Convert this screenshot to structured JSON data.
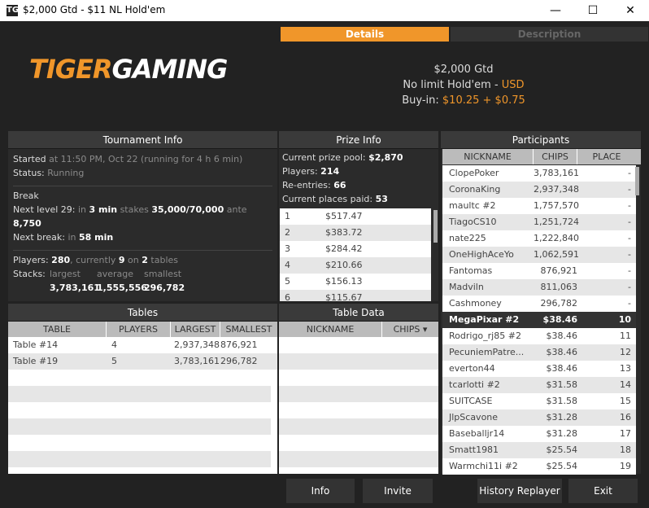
{
  "window": {
    "title": "$2,000 Gtd - $11 NL Hold'em",
    "app_icon": "TG",
    "minimize": "—",
    "maximize": "☐",
    "close": "✕"
  },
  "tabs": {
    "details": "Details",
    "description": "Description"
  },
  "logo": {
    "part1": "TIGER",
    "part2": "GAMING"
  },
  "tournament": {
    "name": "$2,000 Gtd",
    "game": "No limit Hold'em",
    "dash": "-",
    "currency": "USD",
    "buyin_label": "Buy-in:",
    "buyin_value": "$10.25 + $0.75"
  },
  "tournament_info": {
    "title": "Tournament Info",
    "started_label": "Started",
    "started_value": "at 11:50 PM, Oct 22 (running for 4 h 6 min)",
    "status_label": "Status:",
    "status_value": "Running",
    "break": "Break",
    "next_level_label": "Next level 29:",
    "in1": "in",
    "next_level_time": "3 min",
    "stakes_label": "stakes",
    "stakes_value": "35,000/70,000",
    "ante_label": "ante",
    "ante_value": "8,750",
    "next_break_label": "Next break:",
    "in2": "in",
    "next_break_value": "58 min",
    "players_label": "Players:",
    "players_total": "280",
    "currently": ", currently",
    "players_current": "9",
    "on": "on",
    "tables_count": "2",
    "tables_word": "tables",
    "stacks_label": "Stacks:",
    "largest_label": "largest",
    "average_label": "average",
    "smallest_label": "smallest",
    "largest": "3,783,161",
    "average": "1,555,556",
    "smallest": "296,782"
  },
  "prize_info": {
    "title": "Prize Info",
    "pool_label": "Current prize pool:",
    "pool_value": "$2,870",
    "players_label": "Players:",
    "players_value": "214",
    "reentries_label": "Re-entries:",
    "reentries_value": "66",
    "places_label": "Current places paid:",
    "places_value": "53",
    "payouts": [
      {
        "place": "1",
        "amount": "$517.47"
      },
      {
        "place": "2",
        "amount": "$383.72"
      },
      {
        "place": "3",
        "amount": "$284.42"
      },
      {
        "place": "4",
        "amount": "$210.66"
      },
      {
        "place": "5",
        "amount": "$156.13"
      },
      {
        "place": "6",
        "amount": "$115.67"
      }
    ]
  },
  "participants": {
    "title": "Participants",
    "columns": [
      "NICKNAME",
      "CHIPS",
      "PLACE"
    ],
    "rows": [
      {
        "name": "ClopePoker",
        "chips": "3,783,161",
        "place": "-"
      },
      {
        "name": "CoronaKing",
        "chips": "2,937,348",
        "place": "-"
      },
      {
        "name": "maultc #2",
        "chips": "1,757,570",
        "place": "-"
      },
      {
        "name": "TiagoCS10",
        "chips": "1,251,724",
        "place": "-"
      },
      {
        "name": "nate225",
        "chips": "1,222,840",
        "place": "-"
      },
      {
        "name": "OneHighAceYo",
        "chips": "1,062,591",
        "place": "-"
      },
      {
        "name": "Fantomas",
        "chips": "876,921",
        "place": "-"
      },
      {
        "name": "Madviln",
        "chips": "811,063",
        "place": "-"
      },
      {
        "name": "Cashmoney",
        "chips": "296,782",
        "place": "-"
      },
      {
        "name": "MegaPixar #2",
        "chips": "$38.46",
        "place": "10"
      },
      {
        "name": "Rodrigo_rj85 #2",
        "chips": "$38.46",
        "place": "11"
      },
      {
        "name": "PecuniemPatre...",
        "chips": "$38.46",
        "place": "12"
      },
      {
        "name": "everton44",
        "chips": "$38.46",
        "place": "13"
      },
      {
        "name": "tcarlotti #2",
        "chips": "$31.58",
        "place": "14"
      },
      {
        "name": "SUITCASE",
        "chips": "$31.58",
        "place": "15"
      },
      {
        "name": "JlpScavone",
        "chips": "$31.28",
        "place": "16"
      },
      {
        "name": "Baseballjr14",
        "chips": "$31.28",
        "place": "17"
      },
      {
        "name": "Smatt1981",
        "chips": "$25.54",
        "place": "18"
      },
      {
        "name": "Warmchi11i #2",
        "chips": "$25.54",
        "place": "19"
      }
    ]
  },
  "tables": {
    "title": "Tables",
    "columns": [
      "TABLE",
      "PLAYERS",
      "LARGEST",
      "SMALLEST"
    ],
    "rows": [
      {
        "table": "Table #14",
        "players": "4",
        "largest": "2,937,348",
        "smallest": "876,921"
      },
      {
        "table": "Table #19",
        "players": "5",
        "largest": "3,783,161",
        "smallest": "296,782"
      }
    ]
  },
  "table_data": {
    "title": "Table Data",
    "columns": [
      "NICKNAME",
      "CHIPS"
    ]
  },
  "buttons": {
    "info": "Info",
    "invite": "Invite",
    "history": "History Replayer",
    "exit": "Exit"
  },
  "colors": {
    "accent": "#f0962a",
    "background": "#222222",
    "panel": "#2b2b2b"
  }
}
